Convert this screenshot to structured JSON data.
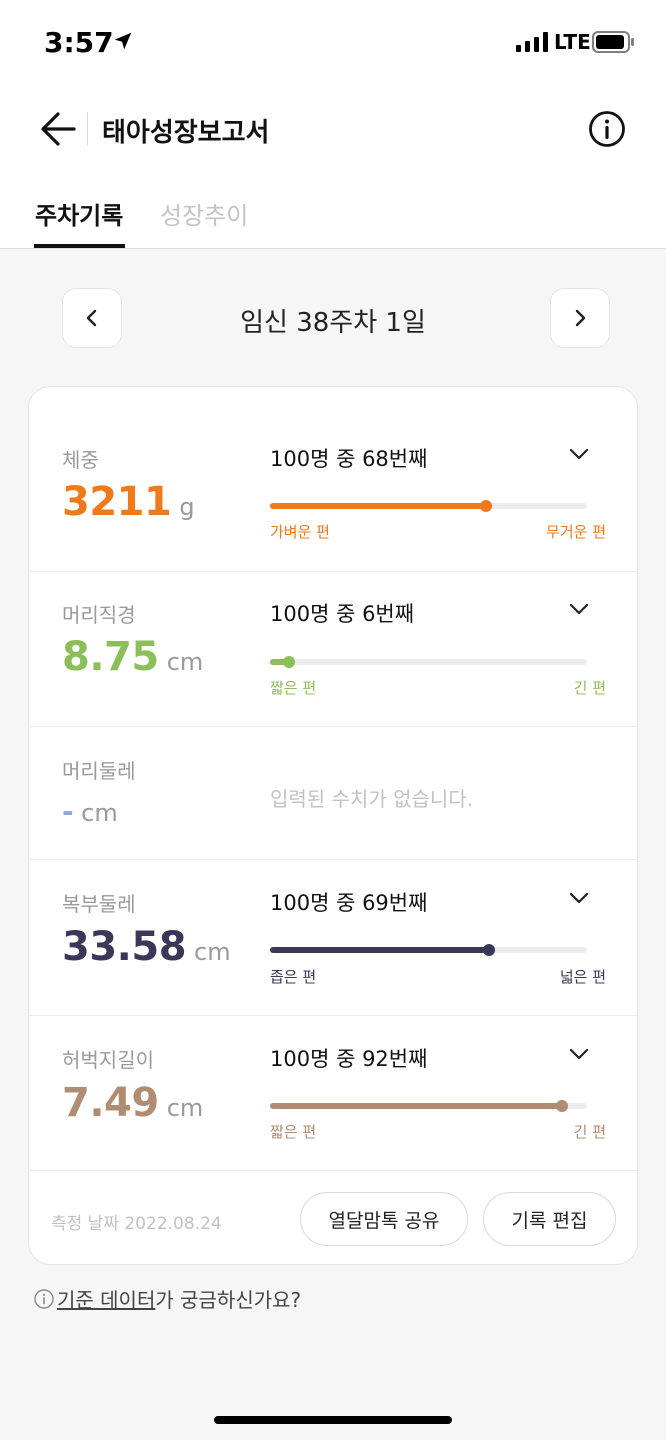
{
  "status_bar": {
    "time": "3:57",
    "network": "LTE"
  },
  "header": {
    "title": "태아성장보고서"
  },
  "tabs": [
    {
      "label": "주차기록",
      "active": true
    },
    {
      "label": "성장추이",
      "active": false
    }
  ],
  "week_nav": {
    "title": "임신 38주차 1일"
  },
  "measurements": [
    {
      "label": "체중",
      "value": "3211",
      "unit": "g",
      "color": "#f07a1a",
      "rank": "100명 중 68번째",
      "percentile": 0.68,
      "left_label": "가벼운 편",
      "right_label": "무거운 편"
    },
    {
      "label": "머리직경",
      "value": "8.75",
      "unit": "cm",
      "color": "#8cbf5a",
      "rank": "100명 중 6번째",
      "percentile": 0.06,
      "left_label": "짧은 편",
      "right_label": "긴 편"
    },
    {
      "label": "머리둘레",
      "value": "-",
      "unit": "cm",
      "color": "#8fa8d8",
      "empty_text": "입력된 수치가 없습니다."
    },
    {
      "label": "복부둘레",
      "value": "33.58",
      "unit": "cm",
      "color": "#3a3858",
      "rank": "100명 중 69번째",
      "percentile": 0.69,
      "left_label": "좁은 편",
      "right_label": "넓은 편"
    },
    {
      "label": "허벅지길이",
      "value": "7.49",
      "unit": "cm",
      "color": "#b08c72",
      "rank": "100명 중 92번째",
      "percentile": 0.92,
      "left_label": "짧은 편",
      "right_label": "긴 편"
    }
  ],
  "footer": {
    "date": "측정 날짜 2022.08.24",
    "share_label": "열달맘톡 공유",
    "edit_label": "기록 편집"
  },
  "help": {
    "link_text": "기준 데이터",
    "suffix": "가 궁금하신가요?"
  }
}
